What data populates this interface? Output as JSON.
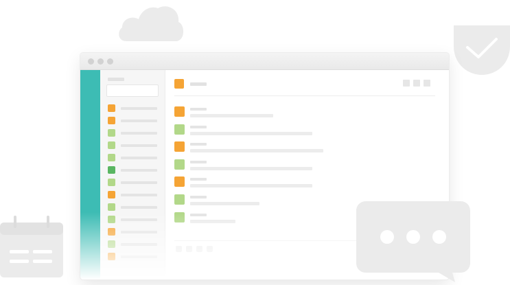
{
  "decor": {
    "cloud_icon": "cloud-icon",
    "shield_icon": "shield-check-icon",
    "calendar_icon": "calendar-icon",
    "chat_icon": "chat-bubble-ellipsis-icon"
  },
  "colors": {
    "rail": "#3dbcb4",
    "orange": "#f5a435",
    "green": "#b2d889",
    "dark_green": "#5ab662",
    "placeholder": "#e4e4e4",
    "decor_gray": "#ebebeb"
  },
  "window": {
    "traffic_lights": 3
  },
  "sidebar": {
    "items": [
      {
        "status": "orange"
      },
      {
        "status": "orange"
      },
      {
        "status": "green"
      },
      {
        "status": "green"
      },
      {
        "status": "green"
      },
      {
        "status": "dark_green"
      },
      {
        "status": "green"
      },
      {
        "status": "orange"
      },
      {
        "status": "green"
      },
      {
        "status": "green"
      },
      {
        "status": "orange"
      },
      {
        "status": "green"
      },
      {
        "status": "orange"
      }
    ]
  },
  "main": {
    "header_status": "orange",
    "header_buttons": 3,
    "rows": [
      {
        "status": "orange"
      },
      {
        "status": "green"
      },
      {
        "status": "orange"
      },
      {
        "status": "green"
      },
      {
        "status": "orange"
      },
      {
        "status": "green"
      },
      {
        "status": "green"
      }
    ]
  }
}
